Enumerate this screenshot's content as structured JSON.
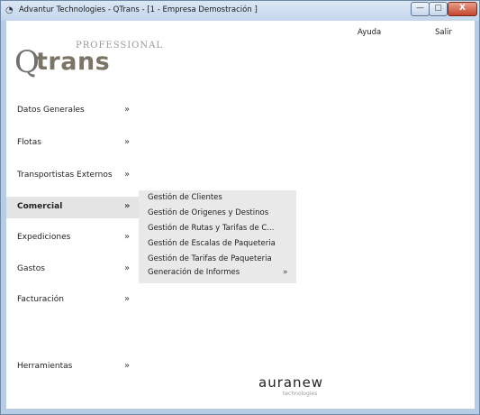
{
  "window": {
    "title": "Advantur Technologies - QTrans - [1 - Empresa Demostración ]"
  },
  "window_controls": {
    "minimize": "—",
    "maximize": "▢",
    "close": "X"
  },
  "logo": {
    "professional": "PROFESSIONAL",
    "q": "Q",
    "trans": "trans"
  },
  "header": {
    "help": "Ayuda",
    "exit": "Salir"
  },
  "menu": [
    {
      "label": "Datos Generales",
      "arrow": "»"
    },
    {
      "label": "Flotas",
      "arrow": "»"
    },
    {
      "label": "Transportistas Externos",
      "arrow": "»"
    },
    {
      "label": "Comercial",
      "arrow": "»"
    },
    {
      "label": "Expediciones",
      "arrow": "»"
    },
    {
      "label": "Gastos",
      "arrow": "»"
    },
    {
      "label": "Facturación",
      "arrow": "»"
    },
    {
      "label": "Herramientas",
      "arrow": "»"
    }
  ],
  "submenu": [
    {
      "label": "Gestión de Clientes"
    },
    {
      "label": "Gestión de Origenes y Destinos"
    },
    {
      "label": "Gestión de Rutas y Tarifas de C..."
    },
    {
      "label": "Gestión de Escalas de Paqueteria"
    },
    {
      "label": "Gestión de Tarifas de Paqueteria"
    },
    {
      "label": "Generación de Informes",
      "arrow": "»"
    }
  ],
  "footer": {
    "brand": "auranew",
    "tagline": "technologies"
  },
  "colors": {
    "frame": "#b7cde6",
    "active_menu": "#e4e4e4",
    "submenu_bg": "#e9e9e9",
    "close_button": "#c4452b"
  }
}
